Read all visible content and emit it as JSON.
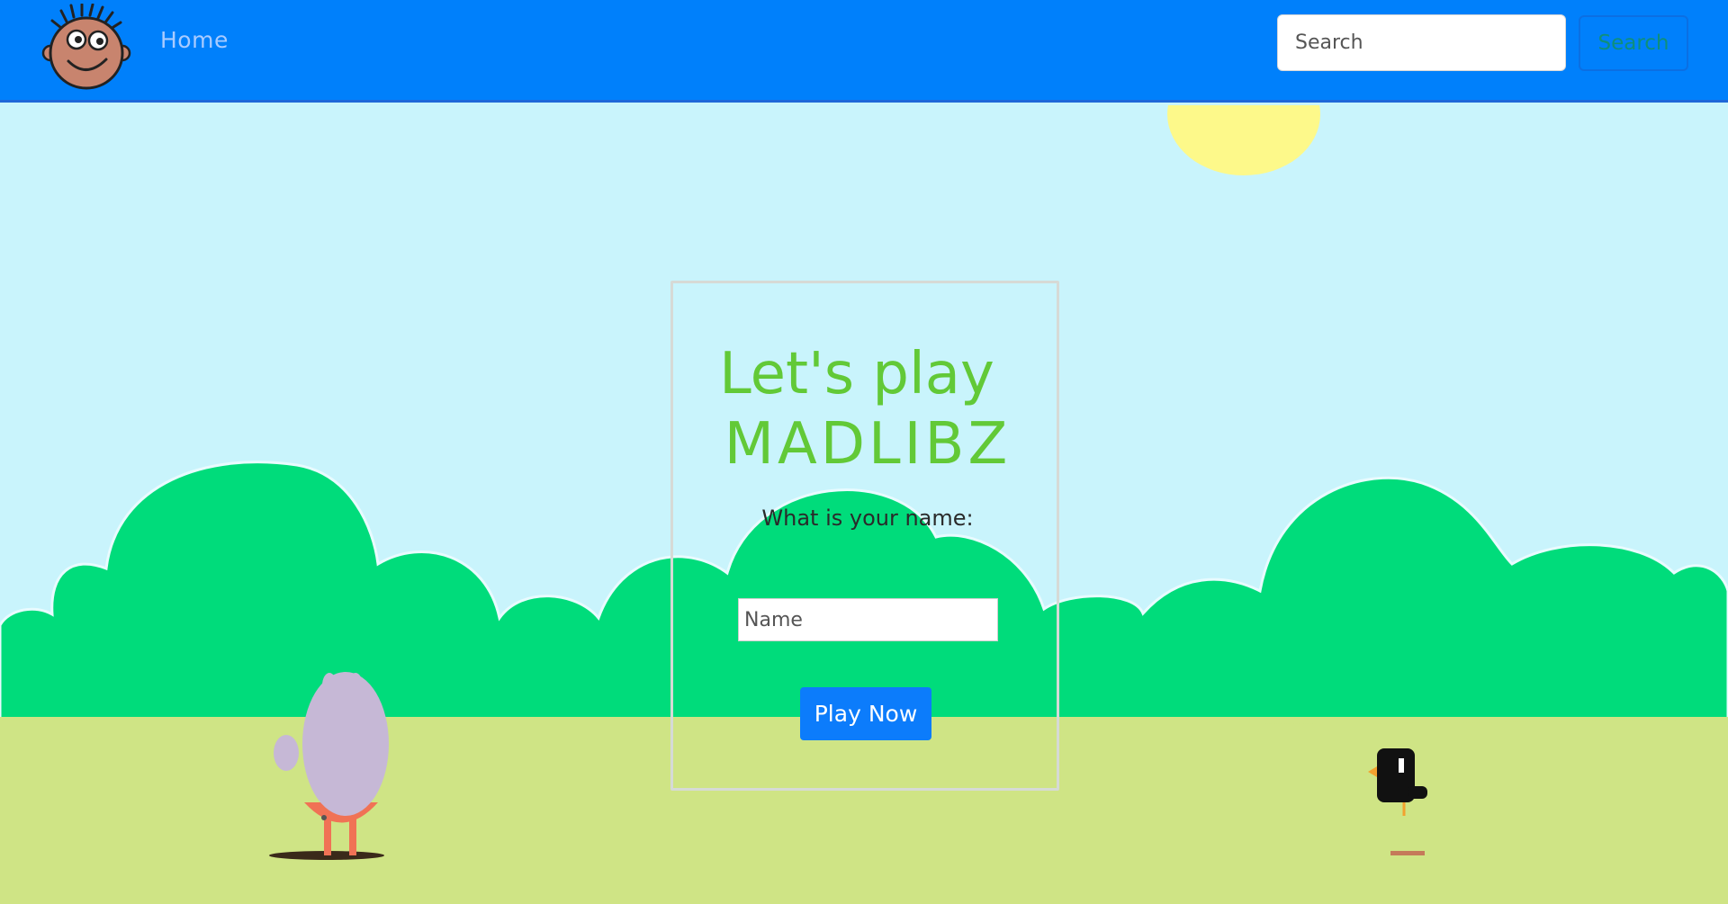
{
  "navbar": {
    "logo_icon": "cartoon-face-icon",
    "home_label": "Home",
    "search": {
      "placeholder": "Search",
      "value": "",
      "button_label": "Search"
    }
  },
  "card": {
    "title_line1": "Let's play",
    "title_line2": "MADLIBZ",
    "prompt": "What is your name:",
    "name_input": {
      "placeholder": "Name",
      "value": ""
    },
    "play_button_label": "Play Now"
  },
  "colors": {
    "navbar": "#0080fb",
    "sky": "#c9f4fc",
    "hills": "#00dc7b",
    "grass": "#cfe485",
    "sun": "#fdf98a",
    "title": "#62c937",
    "button": "#0c7cfb"
  }
}
